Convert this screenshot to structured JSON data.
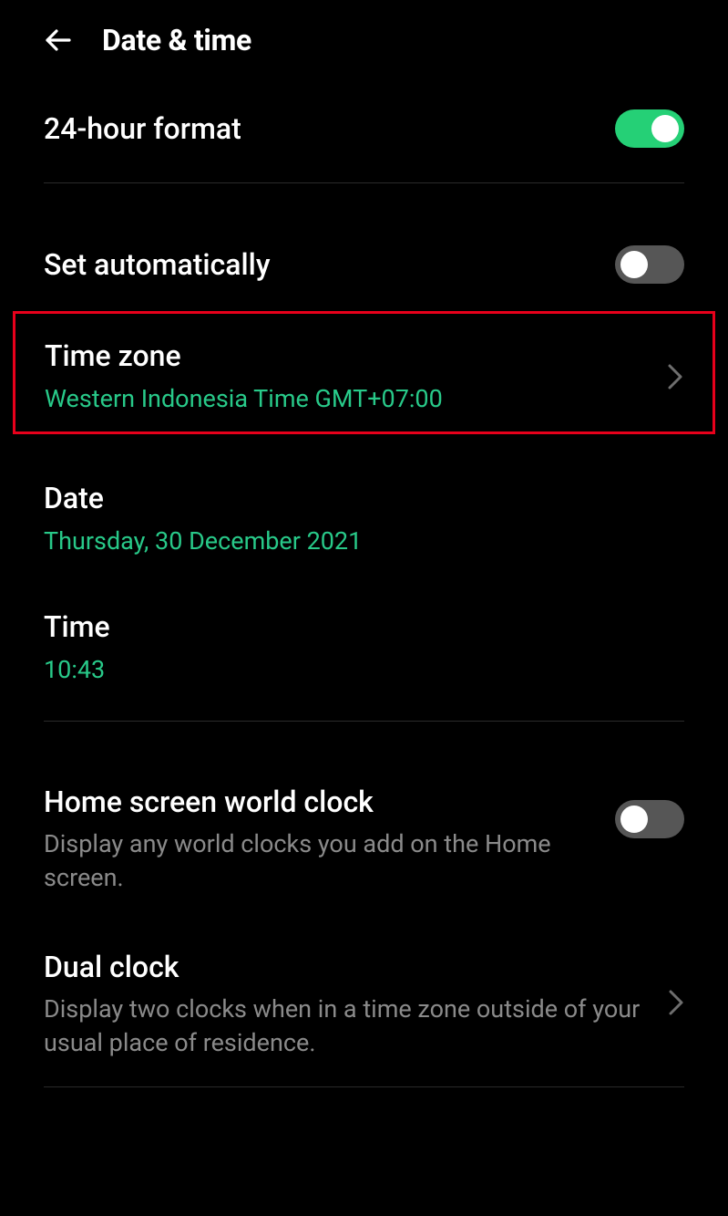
{
  "header": {
    "title": "Date & time"
  },
  "settings": {
    "hour_format": {
      "label": "24-hour format",
      "enabled": true
    },
    "set_auto": {
      "label": "Set automatically",
      "enabled": false
    },
    "timezone": {
      "label": "Time zone",
      "value": "Western Indonesia Time GMT+07:00"
    },
    "date": {
      "label": "Date",
      "value": "Thursday, 30 December 2021"
    },
    "time": {
      "label": "Time",
      "value": "10:43"
    },
    "world_clock": {
      "label": "Home screen world clock",
      "desc": "Display any world clocks you add on the Home screen.",
      "enabled": false
    },
    "dual_clock": {
      "label": "Dual clock",
      "desc": "Display two clocks when in a time zone outside of your usual place of residence."
    }
  },
  "colors": {
    "accent": "#28c989",
    "highlight": "#e8001b"
  }
}
